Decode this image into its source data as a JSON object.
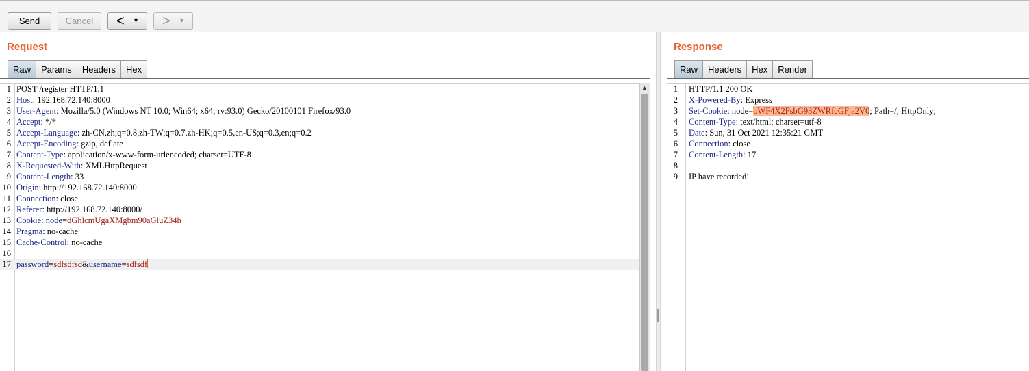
{
  "toolbar": {
    "send_label": "Send",
    "cancel_label": "Cancel",
    "back_glyph": "<",
    "forward_glyph": ">",
    "dropdown_glyph": "▾"
  },
  "request": {
    "title": "Request",
    "tabs": [
      "Raw",
      "Params",
      "Headers",
      "Hex"
    ],
    "active_tab": "Raw",
    "lines": [
      {
        "n": "1",
        "parts": [
          {
            "t": "POST /register HTTP/1.1"
          }
        ]
      },
      {
        "n": "2",
        "parts": [
          {
            "t": "Host",
            "c": "k"
          },
          {
            "t": ": 192.168.72.140:8000"
          }
        ]
      },
      {
        "n": "3",
        "parts": [
          {
            "t": "User-Agent",
            "c": "k"
          },
          {
            "t": ": Mozilla/5.0 (Windows NT 10.0; Win64; x64; rv:93.0) Gecko/20100101 Firefox/93.0"
          }
        ]
      },
      {
        "n": "4",
        "parts": [
          {
            "t": "Accept",
            "c": "k"
          },
          {
            "t": ": */*"
          }
        ]
      },
      {
        "n": "5",
        "parts": [
          {
            "t": "Accept-Language",
            "c": "k"
          },
          {
            "t": ": zh-CN,zh;q=0.8,zh-TW;q=0.7,zh-HK;q=0.5,en-US;q=0.3,en;q=0.2"
          }
        ]
      },
      {
        "n": "6",
        "parts": [
          {
            "t": "Accept-Encoding",
            "c": "k"
          },
          {
            "t": ": gzip, deflate"
          }
        ]
      },
      {
        "n": "7",
        "parts": [
          {
            "t": "Content-Type",
            "c": "k"
          },
          {
            "t": ": application/x-www-form-urlencoded; charset=UTF-8"
          }
        ]
      },
      {
        "n": "8",
        "parts": [
          {
            "t": "X-Requested-With",
            "c": "k"
          },
          {
            "t": ": XMLHttpRequest"
          }
        ]
      },
      {
        "n": "9",
        "parts": [
          {
            "t": "Content-Length",
            "c": "k"
          },
          {
            "t": ": 33"
          }
        ]
      },
      {
        "n": "10",
        "parts": [
          {
            "t": "Origin",
            "c": "k"
          },
          {
            "t": ": http://192.168.72.140:8000"
          }
        ]
      },
      {
        "n": "11",
        "parts": [
          {
            "t": "Connection",
            "c": "k"
          },
          {
            "t": ": close"
          }
        ]
      },
      {
        "n": "12",
        "parts": [
          {
            "t": "Referer",
            "c": "k"
          },
          {
            "t": ": http://192.168.72.140:8000/"
          }
        ]
      },
      {
        "n": "13",
        "parts": [
          {
            "t": "Cookie",
            "c": "k"
          },
          {
            "t": ": "
          },
          {
            "t": "node",
            "c": "k"
          },
          {
            "t": "="
          },
          {
            "t": "dGhlcmUgaXMgbm90aGluZ34h",
            "c": "v"
          }
        ]
      },
      {
        "n": "14",
        "parts": [
          {
            "t": "Pragma",
            "c": "k"
          },
          {
            "t": ": no-cache"
          }
        ]
      },
      {
        "n": "15",
        "parts": [
          {
            "t": "Cache-Control",
            "c": "k"
          },
          {
            "t": ": no-cache"
          }
        ]
      },
      {
        "n": "16",
        "parts": []
      },
      {
        "n": "17",
        "current": true,
        "caret": true,
        "parts": [
          {
            "t": "password",
            "c": "k"
          },
          {
            "t": "="
          },
          {
            "t": "sdfsdfsd",
            "c": "v"
          },
          {
            "t": "&"
          },
          {
            "t": "username",
            "c": "k"
          },
          {
            "t": "="
          },
          {
            "t": "sdfsdf",
            "c": "v"
          }
        ]
      }
    ]
  },
  "response": {
    "title": "Response",
    "tabs": [
      "Raw",
      "Headers",
      "Hex",
      "Render"
    ],
    "active_tab": "Raw",
    "lines": [
      {
        "n": "1",
        "parts": [
          {
            "t": "HTTP/1.1 200 OK"
          }
        ]
      },
      {
        "n": "2",
        "parts": [
          {
            "t": "X-Powered-By",
            "c": "k"
          },
          {
            "t": ": Express"
          }
        ]
      },
      {
        "n": "3",
        "parts": [
          {
            "t": "Set-Cookie",
            "c": "k"
          },
          {
            "t": ": node="
          },
          {
            "t": "bWF4X2FsbG93ZWRfcGFja2V0",
            "c": "hl"
          },
          {
            "t": "; Path=/; HttpOnly;"
          }
        ]
      },
      {
        "n": "4",
        "parts": [
          {
            "t": "Content-Type",
            "c": "k"
          },
          {
            "t": ": text/html; charset=utf-8"
          }
        ]
      },
      {
        "n": "5",
        "parts": [
          {
            "t": "Date",
            "c": "k"
          },
          {
            "t": ": Sun, 31 Oct 2021 12:35:21 GMT"
          }
        ]
      },
      {
        "n": "6",
        "parts": [
          {
            "t": "Connection",
            "c": "k"
          },
          {
            "t": ": close"
          }
        ]
      },
      {
        "n": "7",
        "parts": [
          {
            "t": "Content-Length",
            "c": "k"
          },
          {
            "t": ": 17"
          }
        ]
      },
      {
        "n": "8",
        "parts": []
      },
      {
        "n": "9",
        "parts": [
          {
            "t": "IP have recorded!"
          }
        ]
      }
    ]
  },
  "icons": {
    "scroll_up": "scroll-up-arrow-icon",
    "back": "chevron-left-icon",
    "forward": "chevron-right-icon"
  }
}
